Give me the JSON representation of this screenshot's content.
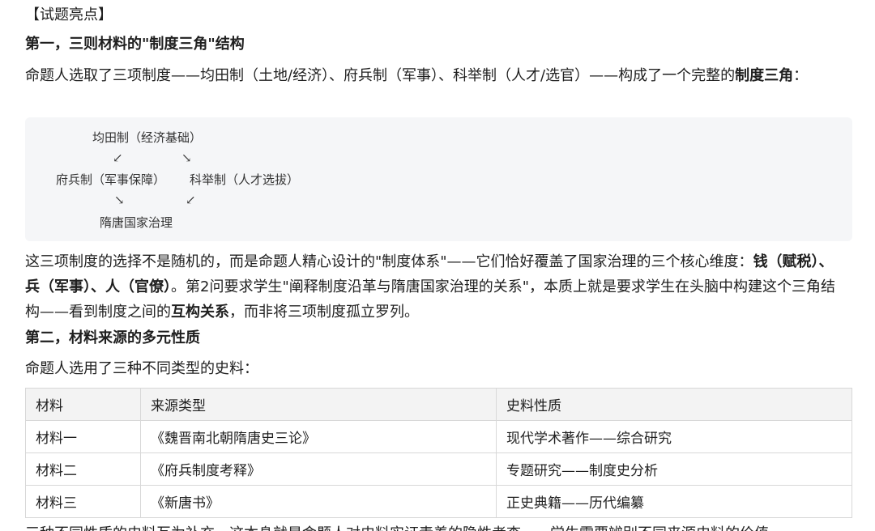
{
  "section_label": "【试题亮点】",
  "heading1": "第一，三则材料的\"制度三角\"结构",
  "para1": {
    "t1": "命题人选取了三项制度——均田制（土地/经济）、府兵制（军事）、科举制（人才/选官）——构成了一个完整的",
    "b1": "制度三角",
    "t2": "："
  },
  "diagram": {
    "top": "均田制（经济基础）",
    "arrow_tl": "↙",
    "arrow_tr": "↘",
    "left": "府兵制（军事保障）",
    "right": "科举制（人才选拔）",
    "arrow_bl": "↘",
    "arrow_br": "↙",
    "bottom": "隋唐国家治理"
  },
  "para2": {
    "t1": "这三项制度的选择不是随机的，而是命题人精心设计的\"制度体系\"——它们恰好覆盖了国家治理的三个核心维度：",
    "b1": "钱（赋税）、兵（军事）、人（官僚）",
    "t2": "。第2问要求学生\"阐释制度沿革与隋唐国家治理的关系\"，本质上就是要求学生在头脑中构建这个三角结构——看到制度之间的",
    "b2": "互构关系",
    "t3": "，而非将三项制度孤立罗列。"
  },
  "heading2": "第二，材料来源的多元性质",
  "para3": "命题人选用了三种不同类型的史料：",
  "table": {
    "headers": [
      "材料",
      "来源类型",
      "史料性质"
    ],
    "rows": [
      [
        "材料一",
        "《魏晋南北朝隋唐史三论》",
        "现代学术著作——综合研究"
      ],
      [
        "材料二",
        "《府兵制度考释》",
        "专题研究——制度史分析"
      ],
      [
        "材料三",
        "《新唐书》",
        "正史典籍——历代编纂"
      ]
    ]
  },
  "cut_line": "三种不同性质的史料互为补充，这本身就是命题人对史料实证素养的隐性考查——学生需要辨别不同来源史料的价值"
}
